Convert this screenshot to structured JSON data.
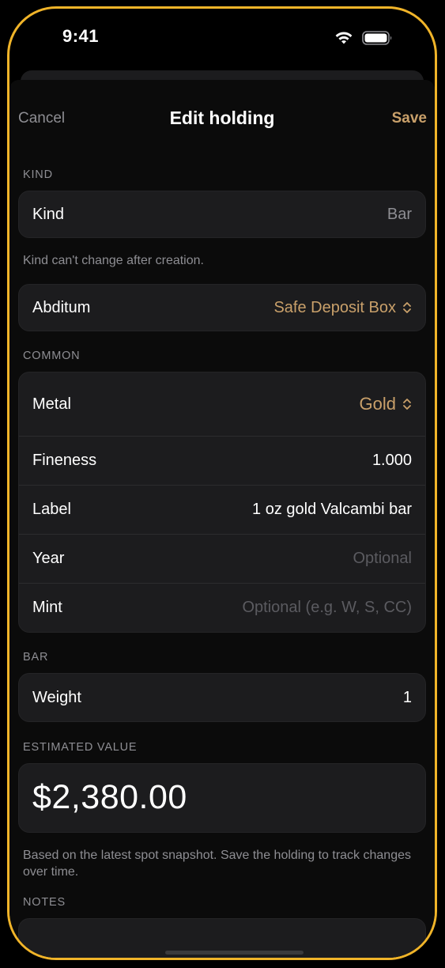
{
  "status_bar": {
    "time": "9:41",
    "wifi_icon": "wifi-icon",
    "battery_icon": "battery-icon"
  },
  "nav": {
    "cancel_label": "Cancel",
    "title": "Edit holding",
    "save_label": "Save"
  },
  "sections": {
    "kind": {
      "header": "KIND",
      "row_label": "Kind",
      "row_value": "Bar",
      "footer": "Kind can't change after creation."
    },
    "location": {
      "row_label": "Abditum",
      "row_value": "Safe Deposit Box",
      "icon": "chevron-up-down-icon"
    },
    "common": {
      "header": "COMMON",
      "rows": {
        "metal": {
          "label": "Metal",
          "value": "Gold",
          "icon": "chevron-up-down-icon"
        },
        "fineness": {
          "label": "Fineness",
          "value": "1.000"
        },
        "label": {
          "label": "Label",
          "value": "1 oz gold Valcambi bar"
        },
        "year": {
          "label": "Year",
          "placeholder": "Optional"
        },
        "mint": {
          "label": "Mint",
          "placeholder": "Optional (e.g. W, S, CC)"
        }
      }
    },
    "bar": {
      "header": "BAR",
      "row_label": "Weight",
      "row_value": "1"
    },
    "estimated_value": {
      "header": "ESTIMATED VALUE",
      "value": "$2,380.00",
      "footer": "Based on the latest spot snapshot. Save the holding to track changes over time."
    },
    "notes": {
      "header": "NOTES"
    }
  },
  "colors": {
    "accent": "#c9a06a",
    "device_frame": "#f0b429",
    "cell_background": "#1c1c1e",
    "secondary_text": "#8e8e93"
  }
}
